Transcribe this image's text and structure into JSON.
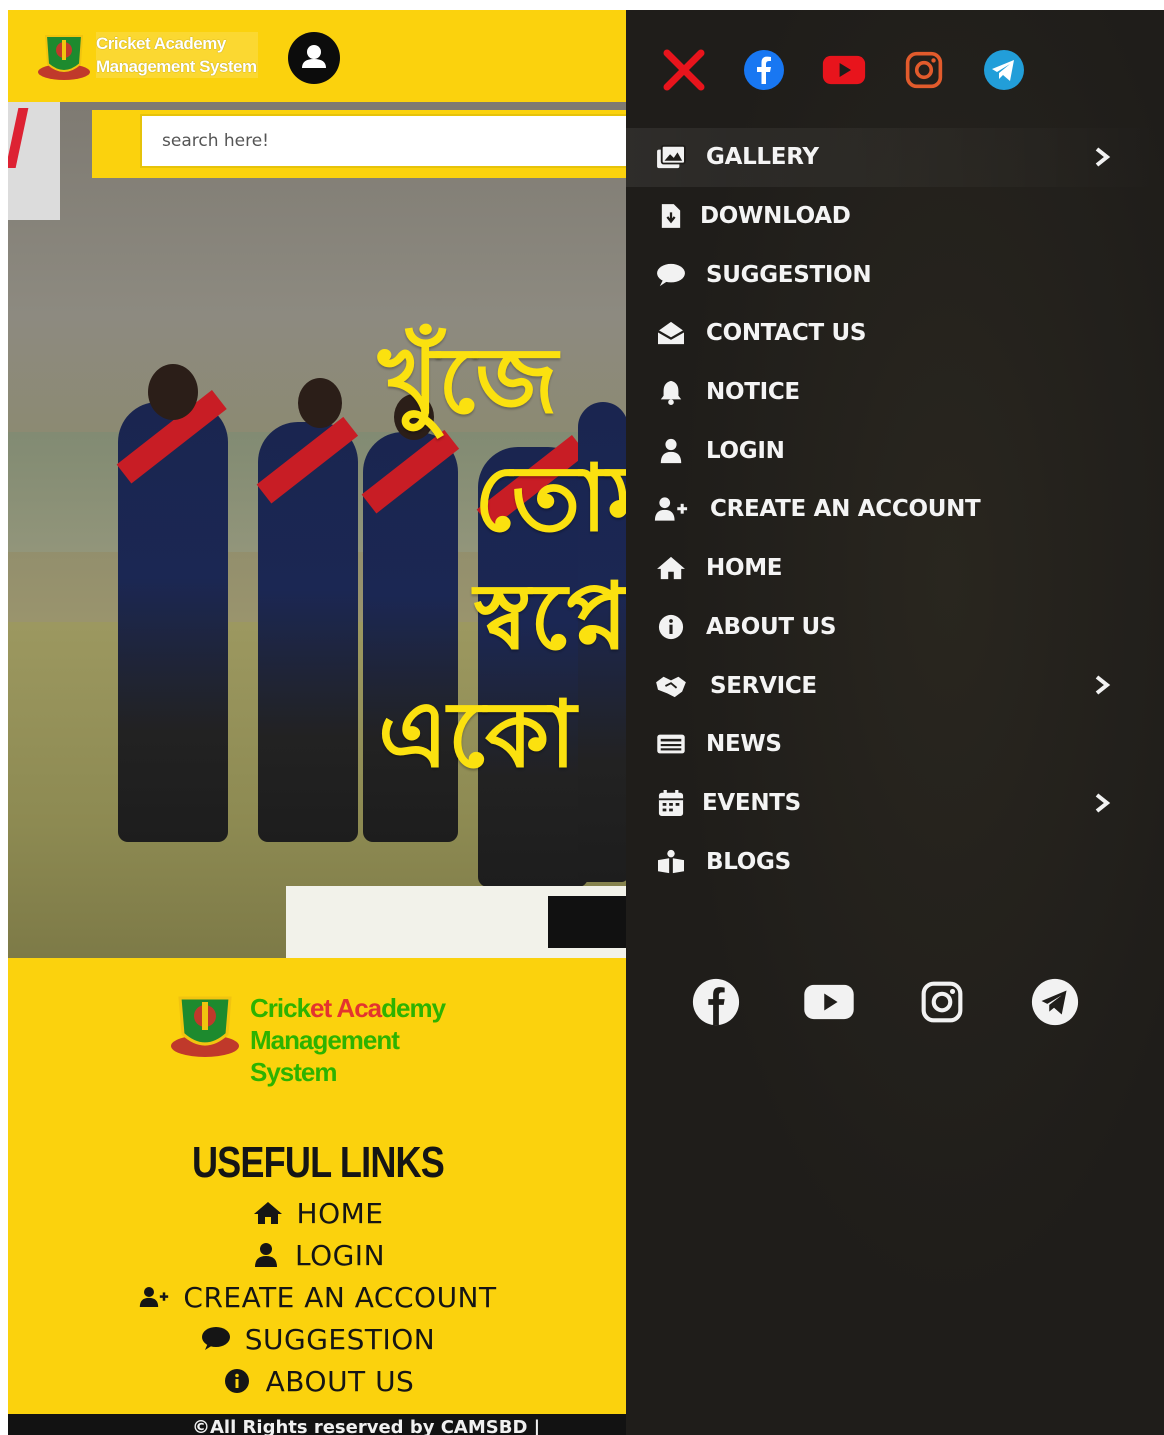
{
  "header": {
    "brand_line1": "Cricket Academy",
    "brand_line2": "Management System"
  },
  "search": {
    "placeholder": "search here!"
  },
  "hero": {
    "headline": "খুঁজে\n   তোম\n   স্বপ্নে\nএকাে"
  },
  "footer": {
    "brand_part1": "Crick",
    "brand_part2": "et Aca",
    "brand_part3": "demy",
    "brand_line2": "Management System",
    "useful_title": "USEFUL LINKS",
    "links": [
      {
        "label": "HOME",
        "icon": "home-icon"
      },
      {
        "label": "LOGIN",
        "icon": "user-icon"
      },
      {
        "label": "CREATE AN ACCOUNT",
        "icon": "user-plus-icon"
      },
      {
        "label": "SUGGESTION",
        "icon": "comment-icon"
      },
      {
        "label": "ABOUT US",
        "icon": "info-icon"
      }
    ],
    "copyright": "©All Rights reserved by CAMSBD |"
  },
  "drawer": {
    "social_top": [
      {
        "name": "close",
        "icon": "close-icon",
        "color": "#e8141c"
      },
      {
        "name": "facebook",
        "icon": "facebook-icon",
        "color": "#1877f2"
      },
      {
        "name": "youtube",
        "icon": "youtube-icon",
        "color": "#e8141c"
      },
      {
        "name": "instagram",
        "icon": "instagram-icon",
        "color": "#e1306c"
      },
      {
        "name": "telegram",
        "icon": "telegram-icon",
        "color": "#229ed9"
      }
    ],
    "menu": [
      {
        "label": "GALLERY",
        "icon": "images-icon",
        "has_submenu": true
      },
      {
        "label": "DOWNLOAD",
        "icon": "file-download-icon",
        "has_submenu": false
      },
      {
        "label": "SUGGESTION",
        "icon": "comment-icon",
        "has_submenu": false
      },
      {
        "label": "CONTACT US",
        "icon": "envelope-open-icon",
        "has_submenu": false
      },
      {
        "label": "NOTICE",
        "icon": "bell-icon",
        "has_submenu": false
      },
      {
        "label": "LOGIN",
        "icon": "user-icon",
        "has_submenu": false
      },
      {
        "label": "CREATE AN ACCOUNT",
        "icon": "user-plus-icon",
        "has_submenu": false
      },
      {
        "label": "HOME",
        "icon": "home-icon",
        "has_submenu": false
      },
      {
        "label": "ABOUT US",
        "icon": "info-icon",
        "has_submenu": false
      },
      {
        "label": "SERVICE",
        "icon": "handshake-icon",
        "has_submenu": true
      },
      {
        "label": "NEWS",
        "icon": "newspaper-icon",
        "has_submenu": false
      },
      {
        "label": "EVENTS",
        "icon": "calendar-icon",
        "has_submenu": true
      },
      {
        "label": "BLOGS",
        "icon": "blog-icon",
        "has_submenu": false
      }
    ],
    "social_bottom": [
      {
        "name": "facebook",
        "icon": "facebook-icon"
      },
      {
        "name": "youtube",
        "icon": "youtube-icon"
      },
      {
        "name": "instagram",
        "icon": "instagram-icon"
      },
      {
        "name": "telegram",
        "icon": "telegram-icon"
      }
    ]
  },
  "colors": {
    "brand_yellow": "#fbd20d",
    "drawer_bg": "#1f1d1a",
    "hero_text": "#fbe10f"
  }
}
